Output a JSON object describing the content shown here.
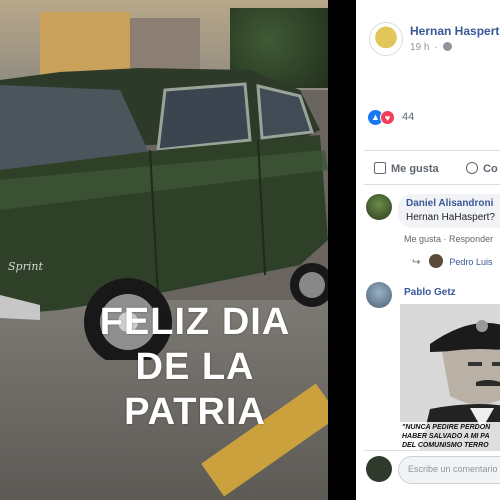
{
  "photo": {
    "car_badge": "Sprint",
    "caption_lines": [
      "FELIZ DIA",
      "DE LA",
      "PATRIA"
    ]
  },
  "post": {
    "author": "Hernan Haspert",
    "time": "19 h",
    "privacy_icon": "globe-icon",
    "reactions": {
      "icons": [
        "like-icon",
        "love-icon"
      ],
      "count": "44"
    },
    "actions": {
      "like_label": "Me gusta",
      "comment_label": "Co"
    }
  },
  "comments": [
    {
      "name": "Daniel Alisandroni",
      "text": "Hernan HaHaspert?",
      "like_label": "Me gusta",
      "reply_label": "Responder",
      "reply_author": "Pedro Luis"
    },
    {
      "name": "Pablo Getz",
      "image_caption_lines": [
        "\"NUNCA PEDIRE PERDON",
        "HABER SALVADO A MI PA",
        "DEL COMUNISMO TERRO"
      ]
    }
  ],
  "composer": {
    "placeholder": "Escribe un comentario"
  },
  "colors": {
    "link": "#385898",
    "like_blue": "#1877f2",
    "love_red": "#f33e58",
    "muted": "#606770"
  }
}
